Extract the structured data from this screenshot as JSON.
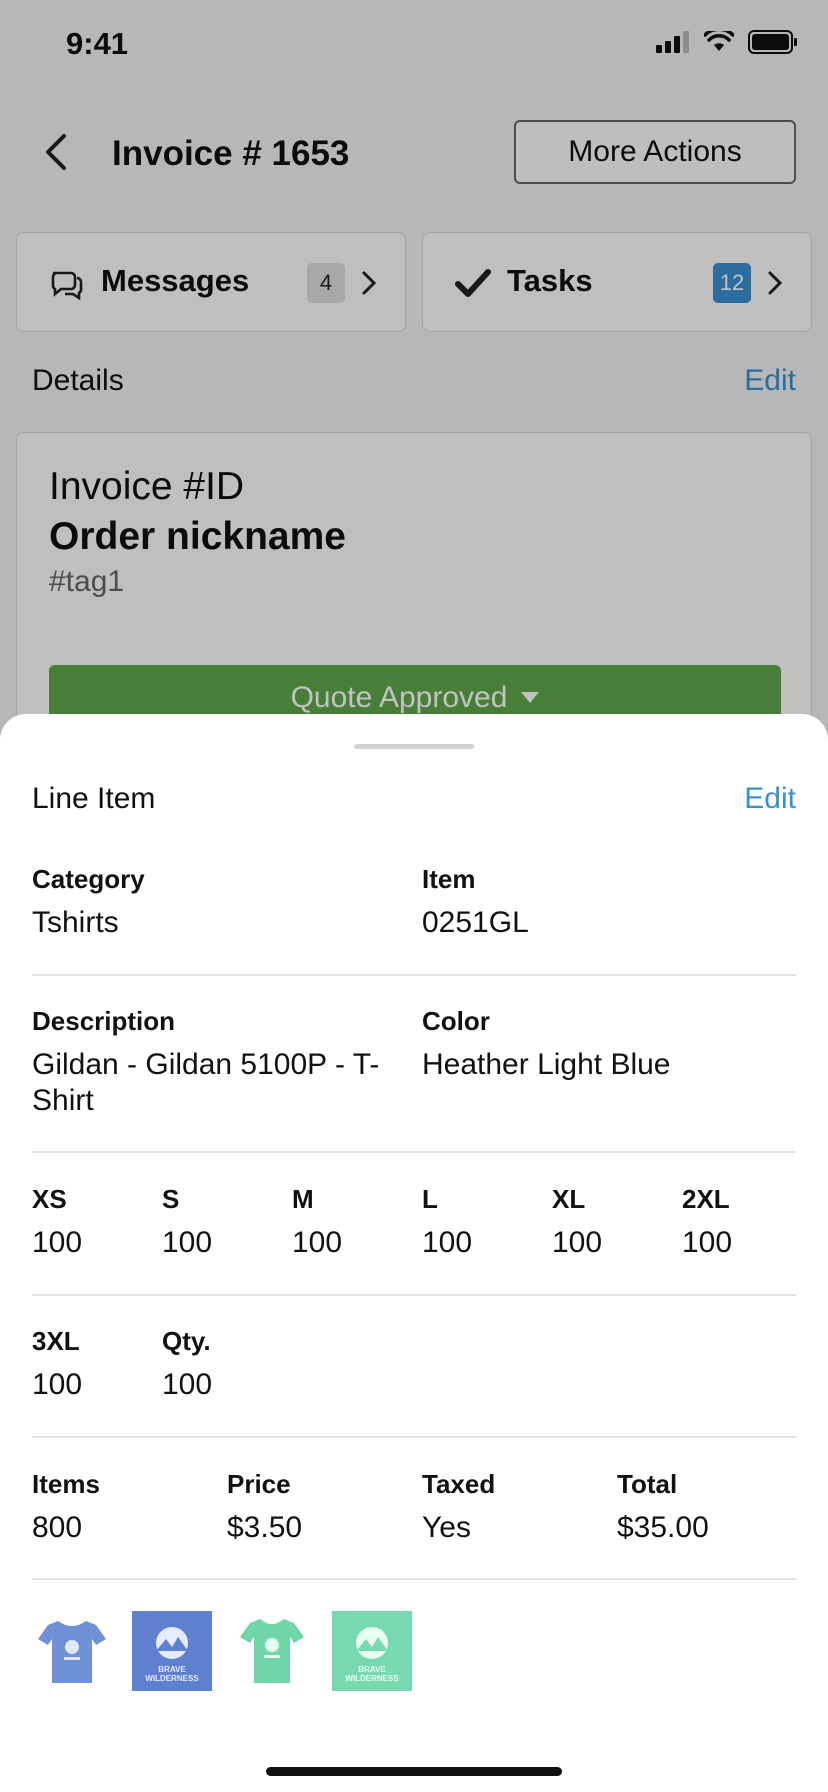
{
  "status_bar": {
    "time": "9:41"
  },
  "nav": {
    "title": "Invoice # 1653",
    "more_actions": "More Actions"
  },
  "tiles": {
    "messages": {
      "label": "Messages",
      "count": "4"
    },
    "tasks": {
      "label": "Tasks",
      "count": "12"
    }
  },
  "details": {
    "header": "Details",
    "edit": "Edit",
    "invoice_id": "Invoice #ID",
    "nickname": "Order nickname",
    "tag": "#tag1",
    "status": "Quote Approved"
  },
  "sheet": {
    "header": "Line Item",
    "edit": "Edit",
    "category_label": "Category",
    "category_value": "Tshirts",
    "item_label": "Item",
    "item_value": "0251GL",
    "description_label": "Description",
    "description_value": "Gildan - Gildan 5100P - T-Shirt",
    "color_label": "Color",
    "color_value": "Heather Light Blue",
    "sizes": [
      {
        "label": "XS",
        "value": "100"
      },
      {
        "label": "S",
        "value": "100"
      },
      {
        "label": "M",
        "value": "100"
      },
      {
        "label": "L",
        "value": "100"
      },
      {
        "label": "XL",
        "value": "100"
      },
      {
        "label": "2XL",
        "value": "100"
      },
      {
        "label": "3XL",
        "value": "100"
      },
      {
        "label": "Qty.",
        "value": "100"
      }
    ],
    "items_label": "Items",
    "items_value": "800",
    "price_label": "Price",
    "price_value": "$3.50",
    "taxed_label": "Taxed",
    "taxed_value": "Yes",
    "total_label": "Total",
    "total_value": "$35.00",
    "thumbnails": [
      {
        "kind": "tshirt-front",
        "color": "#6f8fd6"
      },
      {
        "kind": "design-print",
        "color": "#5f7fcf",
        "text": "BRAVE WILDERNESS"
      },
      {
        "kind": "tshirt-front",
        "color": "#6fd6a8"
      },
      {
        "kind": "design-print",
        "color": "#78d8b0",
        "text": "BRAVE WILDERNESS"
      }
    ]
  },
  "colors": {
    "accent": "#3a90d0",
    "status_green": "#5fa74a",
    "badge_blue": "#3a8ed0"
  }
}
